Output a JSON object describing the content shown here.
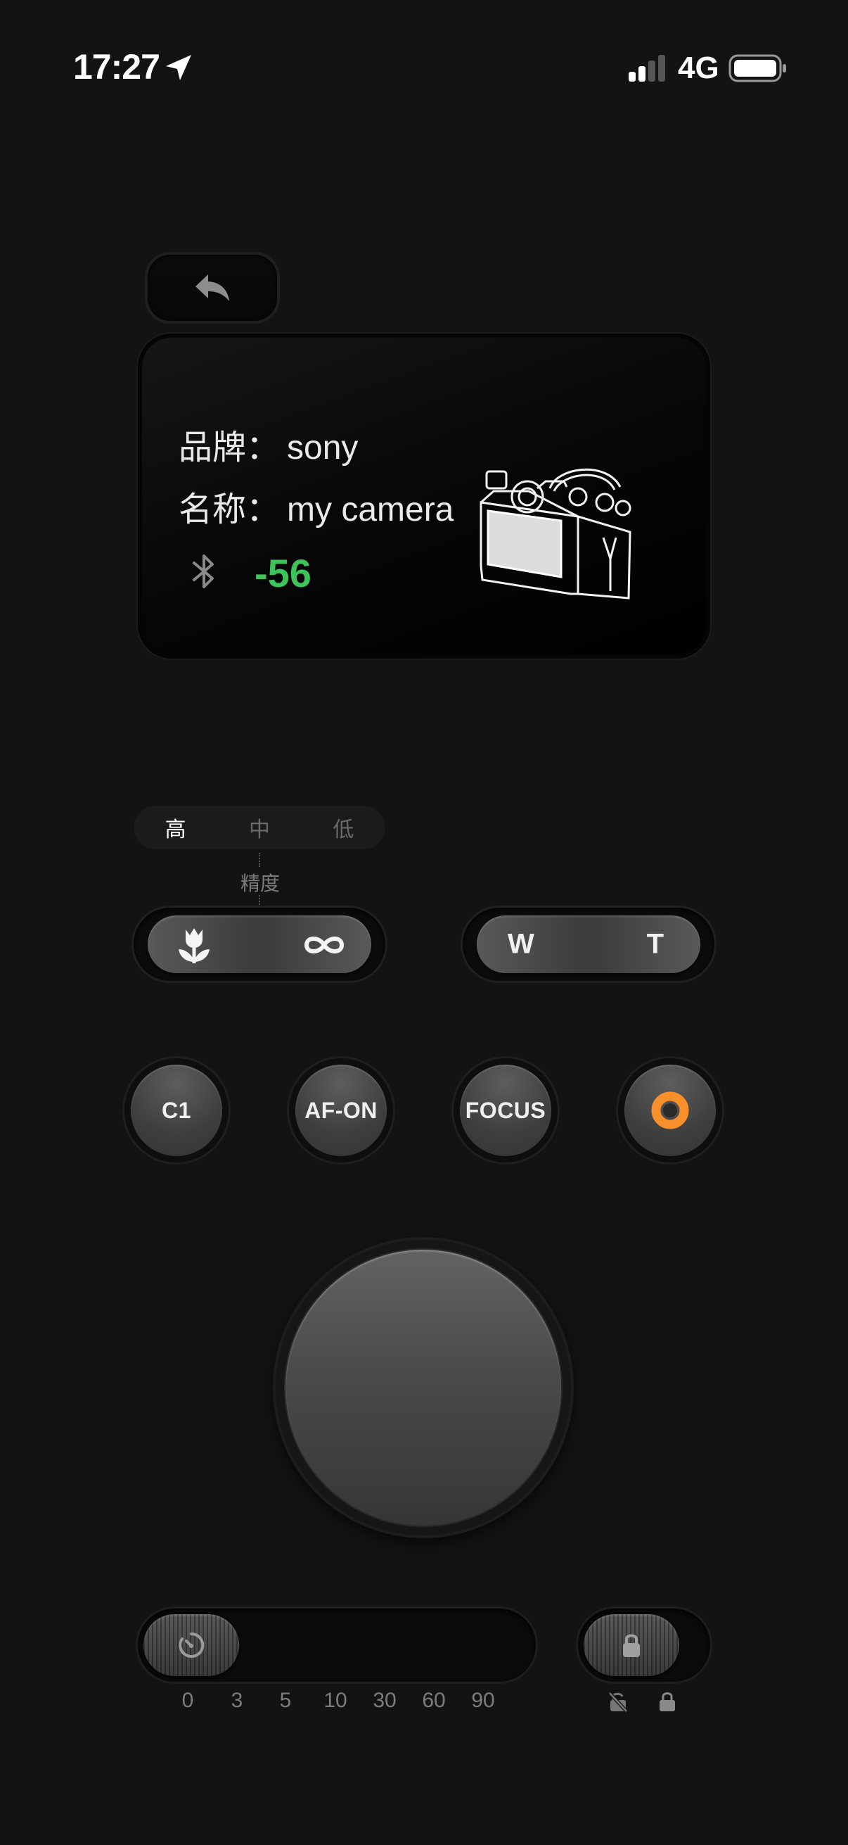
{
  "status_bar": {
    "time": "17:27",
    "network": "4G",
    "icons": [
      "location-arrow-icon",
      "signal-bars-icon",
      "battery-icon"
    ]
  },
  "back_button": {
    "icon": "back-arrow-icon"
  },
  "device_info": {
    "brand_label": "品牌：",
    "brand_value": "sony",
    "name_label": "名称：",
    "name_value": "my camera",
    "rssi": "-56",
    "icons": [
      "bluetooth-icon",
      "camera-illustration"
    ],
    "colors": {
      "rssi": "#3cc35a"
    }
  },
  "precision": {
    "options": [
      "高",
      "中",
      "低"
    ],
    "selected": "高",
    "caption": "精度"
  },
  "focus_toggle": {
    "left_icon": "macro-flower-icon",
    "right_icon": "infinity-icon"
  },
  "zoom_toggle": {
    "left_label": "W",
    "right_label": "T"
  },
  "buttons": {
    "c1": "C1",
    "af_on": "AF-ON",
    "focus": "FOCUS",
    "record_icon": "record-icon",
    "colors": {
      "record": "#f7902a"
    }
  },
  "shutter": {
    "icon": "shutter-button"
  },
  "timer": {
    "icon": "timer-icon",
    "ticks": [
      "0",
      "3",
      "5",
      "10",
      "30",
      "60",
      "90"
    ],
    "selected": "0"
  },
  "lock": {
    "icon": "lock-icon",
    "options": [
      "unlocked-icon",
      "lock-icon"
    ],
    "selected": "unlocked-icon"
  }
}
